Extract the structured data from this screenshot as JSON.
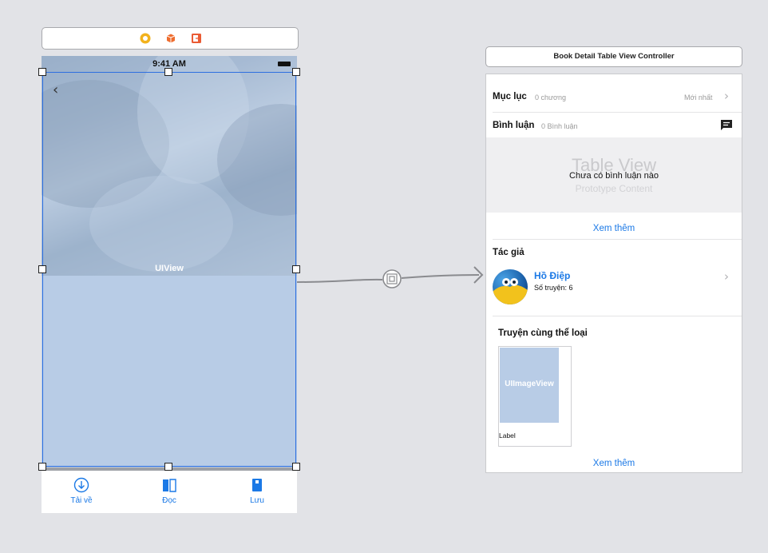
{
  "left_scene": {
    "dock_icons": [
      "view-controller-icon",
      "first-responder-icon",
      "exit-icon"
    ],
    "status_time": "9:41 AM",
    "hero_label": "UIView",
    "tabs": [
      {
        "label": "Tải về",
        "icon": "download-icon"
      },
      {
        "label": "Đọc",
        "icon": "book-open-icon"
      },
      {
        "label": "Lưu",
        "icon": "bookmark-icon"
      }
    ]
  },
  "right_scene": {
    "title": "Book Detail Table View Controller",
    "toc": {
      "title": "Mục lục",
      "count": "0 chương",
      "sort": "Mới nhất"
    },
    "comments": {
      "title": "Bình luận",
      "count": "0 Bình luận"
    },
    "table_view": {
      "title": "Table View",
      "empty": "Chưa có bình luận nào",
      "subtitle": "Prototype Content"
    },
    "see_more_1": "Xem thêm",
    "author": {
      "section": "Tác giả",
      "name": "Hồ Điệp",
      "stories": "Số truyện: 6"
    },
    "related": {
      "section": "Truyện cùng thể loại",
      "image_label": "UIImageView",
      "label": "Label"
    },
    "see_more_2": "Xem thêm"
  },
  "colors": {
    "accent": "#1b79e6",
    "selection": "#2d6fe0",
    "placeholder": "#b8cce6"
  }
}
